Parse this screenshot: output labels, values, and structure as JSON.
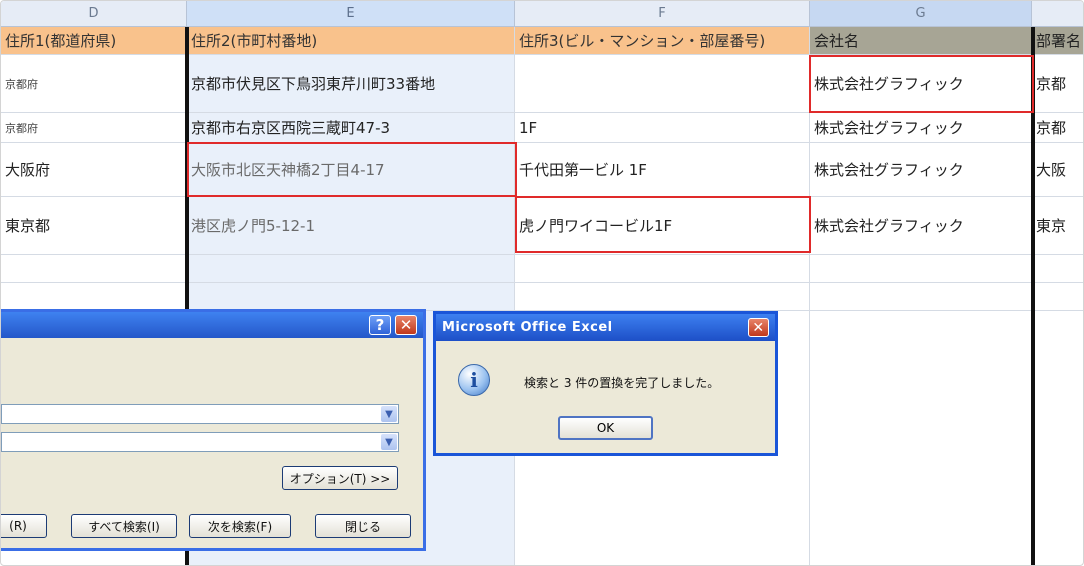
{
  "columns": [
    "D",
    "E",
    "F",
    "G"
  ],
  "header_row": {
    "d": "住所1(都道府県)",
    "e": "住所2(市町村番地)",
    "f": "住所3(ビル・マンション・部屋番号)",
    "g": "会社名",
    "h": "部署名"
  },
  "rows": [
    {
      "d": "京都府",
      "e": "京都市伏見区下鳥羽東芹川町33番地",
      "f": "",
      "g": "株式会社グラフィック",
      "h": "京都"
    },
    {
      "d": "京都府",
      "e": "京都市右京区西院三蔵町47-3",
      "f": "1F",
      "g": "株式会社グラフィック",
      "h": "京都"
    },
    {
      "d": "大阪府",
      "e": "大阪市北区天神橋2丁目4-17",
      "f": "千代田第一ビル 1F",
      "g": "株式会社グラフィック",
      "h": "大阪"
    },
    {
      "d": "東京都",
      "e": "港区虎ノ門5-12-1",
      "f": "虎ノ門ワイコービル1F",
      "g": "株式会社グラフィック",
      "h": "東京"
    }
  ],
  "find_dialog": {
    "help_label": "?",
    "close_label": "✕",
    "options_label": "オプション(T) >>",
    "replace_all_label": "(R)",
    "find_all_label": "すべて検索(I)",
    "find_next_label": "次を検索(F)",
    "close_button_label": "閉じる"
  },
  "message_box": {
    "title": "Microsoft Office Excel",
    "message": "検索と 3 件の置換を完了しました。",
    "ok_label": "OK",
    "close_label": "✕"
  },
  "colors": {
    "header_orange": "#f9c28c",
    "header_company": "#a7a595",
    "highlight_red": "#e02a2a",
    "titlebar_blue": "#2457c9"
  }
}
